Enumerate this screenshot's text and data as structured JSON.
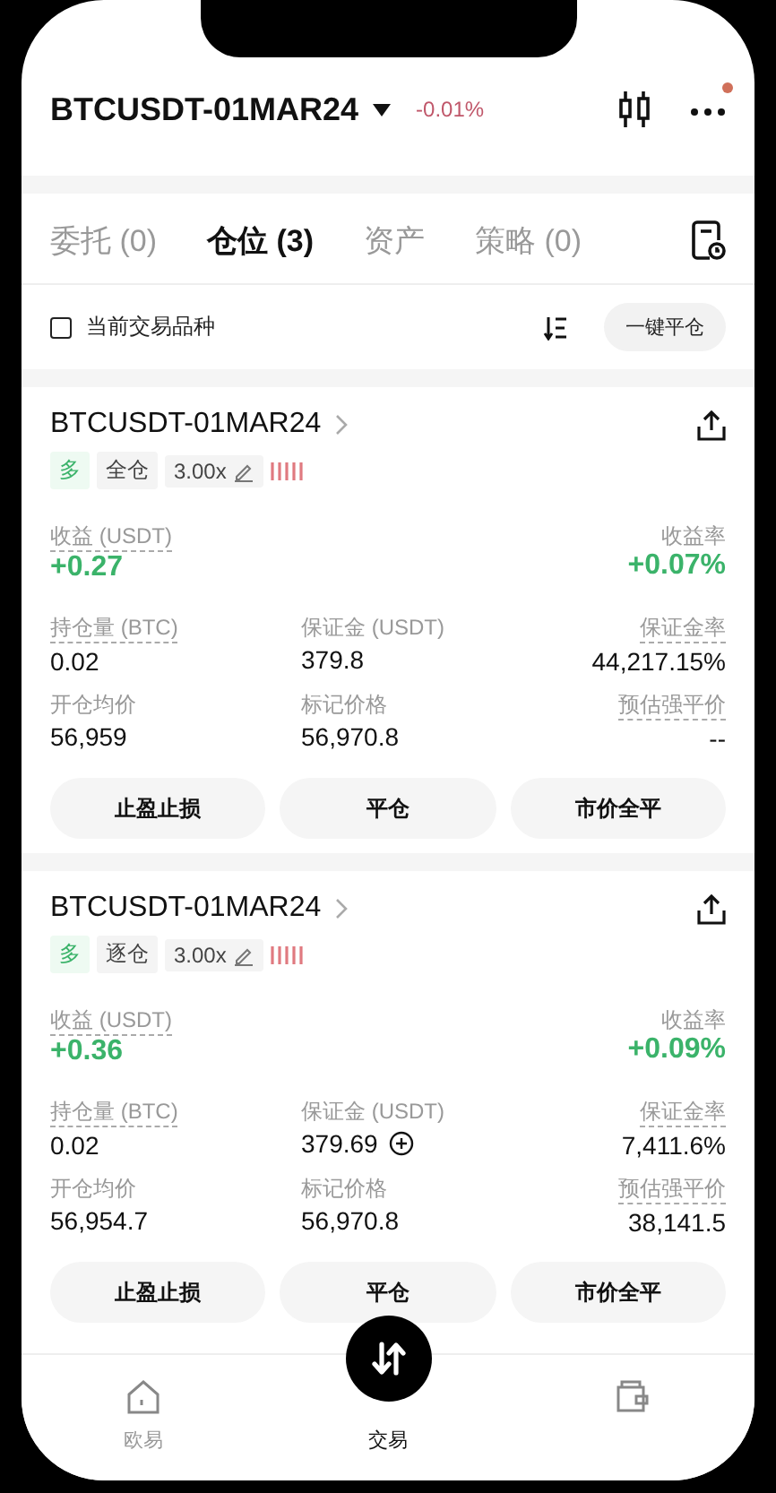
{
  "header": {
    "title": "BTCUSDT-01MAR24",
    "change": "-0.01%",
    "notification": true
  },
  "tabs": [
    {
      "label": "委托 (0)",
      "selected": false
    },
    {
      "label": "仓位 (3)",
      "selected": true
    },
    {
      "label": "资产",
      "selected": false
    },
    {
      "label": "策略 (0)",
      "selected": false
    }
  ],
  "filter": {
    "label": "当前交易品种",
    "checked": false,
    "button": "一键平仓"
  },
  "positions": [
    {
      "symbol": "BTCUSDT-01MAR24",
      "side": "多",
      "margin_mode": "全仓",
      "leverage": "3.00x",
      "pnl_label": "收益 (USDT)",
      "pnl": "+0.27",
      "roe_label": "收益率",
      "roe": "+0.07%",
      "fields": [
        {
          "kind": "plain",
          "label": "持仓量 (BTC)",
          "value": "0.02",
          "dotted": true
        },
        {
          "kind": "plain",
          "label": "保证金 (USDT)",
          "value": "379.8",
          "dotted": false
        },
        {
          "kind": "plain",
          "label": "保证金率",
          "value": "44,217.15%",
          "dotted": true
        },
        {
          "kind": "plain",
          "label": "开仓均价",
          "value": "56,959",
          "dotted": false
        },
        {
          "kind": "plain",
          "label": "标记价格",
          "value": "56,970.8",
          "dotted": false
        },
        {
          "kind": "plain",
          "label": "预估强平价",
          "value": "--",
          "dotted": true
        }
      ],
      "actions": [
        "止盈止损",
        "平仓",
        "市价全平"
      ]
    },
    {
      "symbol": "BTCUSDT-01MAR24",
      "side": "多",
      "margin_mode": "逐仓",
      "leverage": "3.00x",
      "pnl_label": "收益 (USDT)",
      "pnl": "+0.36",
      "roe_label": "收益率",
      "roe": "+0.09%",
      "fields": [
        {
          "kind": "plain",
          "label": "持仓量 (BTC)",
          "value": "0.02",
          "dotted": true
        },
        {
          "kind": "addable",
          "label": "保证金 (USDT)",
          "value": "379.69",
          "dotted": false
        },
        {
          "kind": "plain",
          "label": "保证金率",
          "value": "7,411.6%",
          "dotted": true
        },
        {
          "kind": "plain",
          "label": "开仓均价",
          "value": "56,954.7",
          "dotted": false
        },
        {
          "kind": "plain",
          "label": "标记价格",
          "value": "56,970.8",
          "dotted": false
        },
        {
          "kind": "plain",
          "label": "预估强平价",
          "value": "38,141.5",
          "dotted": true
        }
      ],
      "actions": [
        "止盈止损",
        "平仓",
        "市价全平"
      ]
    }
  ],
  "nav": [
    {
      "kind": "home",
      "label": "欧易",
      "selected": false
    },
    {
      "kind": "trade",
      "label": "交易",
      "selected": true
    },
    {
      "kind": "wallet",
      "selected": false
    }
  ]
}
